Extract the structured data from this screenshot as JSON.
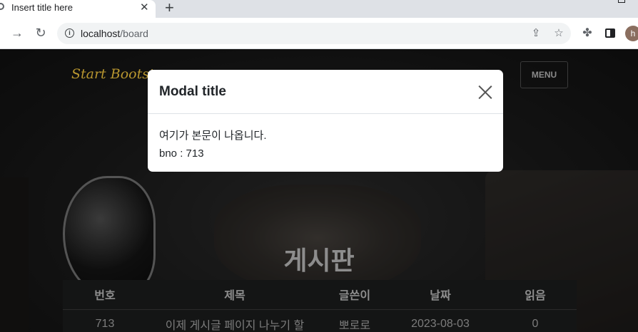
{
  "browser": {
    "tab_title": "Insert title here",
    "url_host": "localhost",
    "url_path": "/board",
    "avatar_letter": "h",
    "icons": [
      "back-arrow-icon",
      "reload-icon",
      "info-icon",
      "share-icon",
      "bookmark-star-icon",
      "extensions-puzzle-icon",
      "side-panel-icon"
    ]
  },
  "site": {
    "brand": "Start Bootst",
    "menu_label": "MENU",
    "heading": "게시판"
  },
  "board": {
    "columns": [
      "번호",
      "제목",
      "글쓴이",
      "날짜",
      "읽음"
    ],
    "rows": [
      {
        "bno": "713",
        "title": "이제 게시글 페이지 나누기 할",
        "writer": "뽀로로",
        "date": "2023-08-03",
        "views": "0"
      }
    ]
  },
  "modal": {
    "title": "Modal title",
    "body_line1": "여기가 본문이 나옵니다.",
    "body_line2": "bno : 713"
  },
  "colors": {
    "brand": "#b8962f",
    "page_bg": "#1a1a1a",
    "table_bg": "#141515",
    "modal_bg": "#ffffff"
  }
}
